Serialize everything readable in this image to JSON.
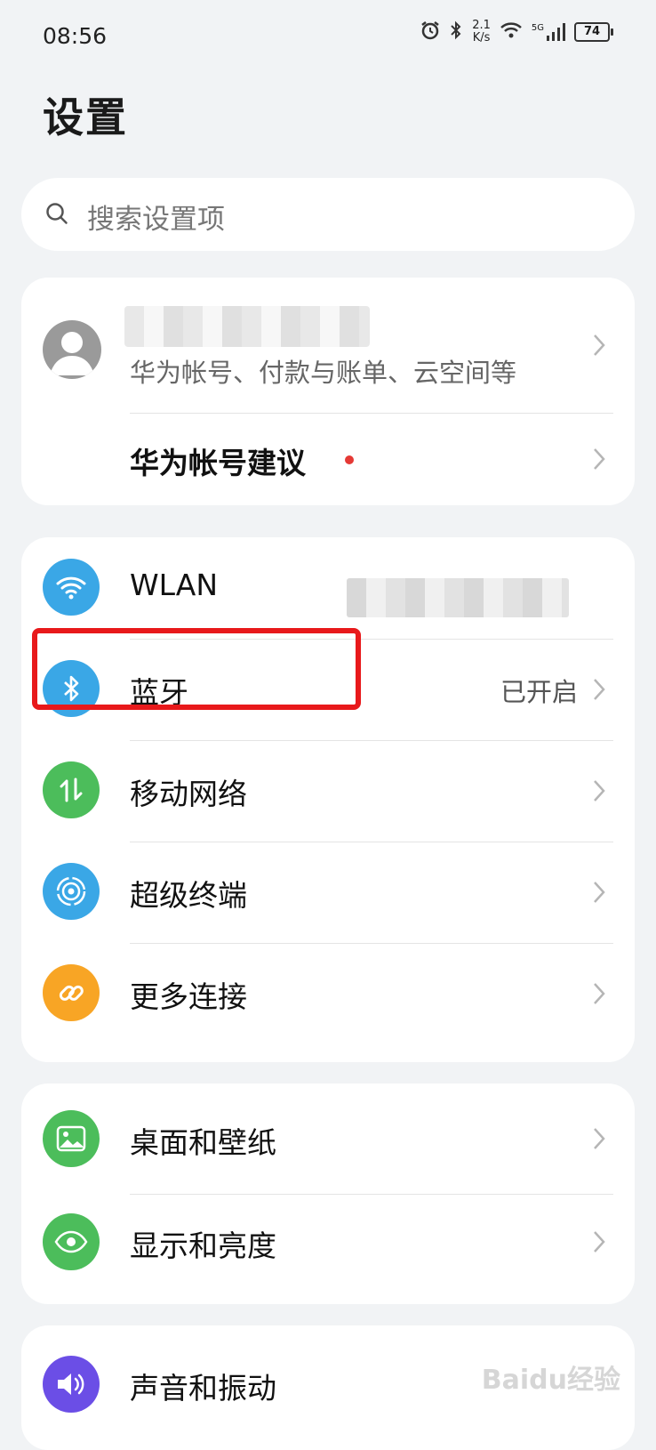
{
  "status_bar": {
    "time": "08:56",
    "net_speed_value": "2.1",
    "net_speed_unit": "K/s",
    "network": "5G",
    "battery": "74"
  },
  "page_title": "设置",
  "search": {
    "placeholder": "搜索设置项"
  },
  "account_card": {
    "subtitle": "华为帐号、付款与账单、云空间等",
    "suggestion_label": "华为帐号建议"
  },
  "connect_card": {
    "items": [
      {
        "label": "WLAN",
        "icon": "wifi-icon",
        "color": "#3aa7e6"
      },
      {
        "label": "蓝牙",
        "status": "已开启",
        "icon": "bluetooth-icon",
        "color": "#3aa7e6"
      },
      {
        "label": "移动网络",
        "icon": "mobile-data-icon",
        "color": "#4cbd5b"
      },
      {
        "label": "超级终端",
        "icon": "super-device-icon",
        "color": "#3aa7e6"
      },
      {
        "label": "更多连接",
        "icon": "link-icon",
        "color": "#f8a525"
      }
    ]
  },
  "display_card": {
    "items": [
      {
        "label": "桌面和壁纸",
        "icon": "wallpaper-icon",
        "color": "#4cbd5b"
      },
      {
        "label": "显示和亮度",
        "icon": "eye-icon",
        "color": "#4cbd5b"
      }
    ]
  },
  "sound_card": {
    "items": [
      {
        "label": "声音和振动",
        "icon": "speaker-icon",
        "color": "#6b4ee6"
      }
    ]
  },
  "watermark": "Baidu经验"
}
